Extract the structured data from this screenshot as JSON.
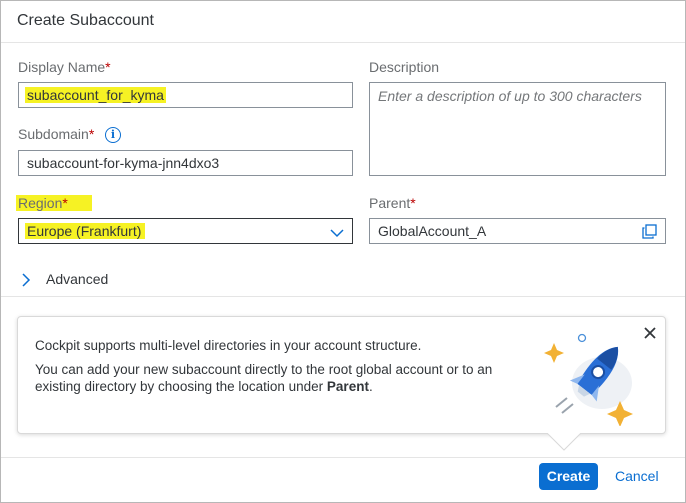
{
  "dialog": {
    "title": "Create Subaccount"
  },
  "form": {
    "display_name": {
      "label": "Display Name",
      "required": "*",
      "value": "subaccount_for_kyma"
    },
    "description": {
      "label": "Description",
      "placeholder": "Enter a description of up to 300 characters"
    },
    "subdomain": {
      "label": "Subdomain",
      "required": "*",
      "value": "subaccount-for-kyma-jnn4dxo3",
      "info_icon": "info-icon"
    },
    "region": {
      "label": "Region",
      "required": "*",
      "value": "Europe (Frankfurt)",
      "icon": "chevron-down-icon"
    },
    "parent": {
      "label": "Parent",
      "required": "*",
      "value": "GlobalAccount_A",
      "icon": "copy-select-icon"
    }
  },
  "advanced": {
    "label": "Advanced",
    "icon": "chevron-right-icon"
  },
  "info_box": {
    "line1": "Cockpit supports multi-level directories in your account structure.",
    "line2a": "You can add your new subaccount directly to the root global account or to an",
    "line2b_prefix": "existing directory by choosing the location under ",
    "line2b_bold": "Parent",
    "line2b_suffix": ".",
    "illustration": "rocket-illustration",
    "close_icon": "close-icon"
  },
  "footer": {
    "create_label": "Create",
    "cancel_label": "Cancel"
  },
  "colors": {
    "accent": "#0a6ed1",
    "required": "#bb0000",
    "highlight": "#f6f224"
  }
}
